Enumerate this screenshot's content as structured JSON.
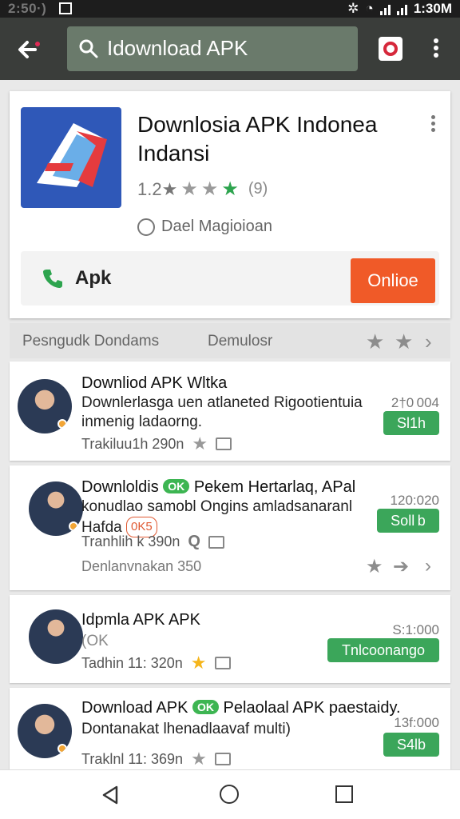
{
  "status_bar": {
    "time": "2:50·)",
    "clock": "1:30M"
  },
  "app_bar": {
    "search_text": "Idownload APK"
  },
  "app_card": {
    "name": "Downlosia APK Indonea Indansi",
    "rating_text": "1.2★",
    "rating_count": "(9)",
    "developer": "Dael Magioioan",
    "action_label": "Apk",
    "action_button": "Onlioe",
    "colors": {
      "action_button": "#f05a28"
    }
  },
  "filters": {
    "left": "Pesngudk Dondams",
    "middle": "Demulosr"
  },
  "items": [
    {
      "title": "Downliod APK Wltka",
      "body": "Downlerlasga uen atlaneted Rigootientuia inmenig ladaorng.",
      "meta": "Trakiluu1h 290n",
      "time": "2†0 004",
      "action": "Sl1h"
    },
    {
      "title": "Downloldis",
      "ok": "OK",
      "title_rest": "Pekem Hertarlaq, APal",
      "body": "konudlao samobl Ongins amladsanaranl Hafda",
      "badge": "0K5",
      "meta": "Tranhlih k 390n",
      "time": "120:020",
      "action": "Soll b",
      "sub_label": "Denlanvnakan 350"
    },
    {
      "title": "Idpmla APK  APK",
      "body": "(OK",
      "meta": "Tadhin 11: 320n",
      "time": "S:1:000",
      "action": "Tnlcoonango"
    },
    {
      "title": "Download APK",
      "ok": "OK",
      "title_rest": "Pelaolaal APK paestaidy.",
      "body": "Dontanakat lhenadlaavaf multi)",
      "meta": "Traklnl 11: 369n",
      "time": "13f:000",
      "action": "S4lb"
    }
  ]
}
